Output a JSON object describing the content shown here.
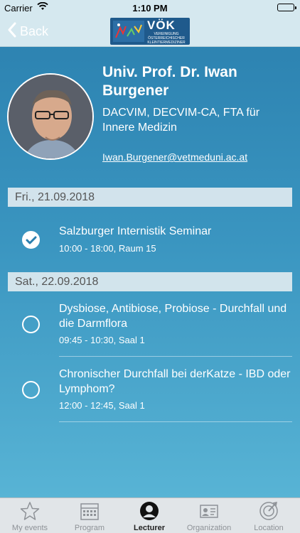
{
  "status_bar": {
    "carrier": "Carrier",
    "time": "1:10 PM"
  },
  "nav": {
    "back_label": "Back",
    "logo_text": "VÖK",
    "logo_subtext": "VEREINIGUNG ÖSTERREICHISCHER KLEINTIERMEDIZINER"
  },
  "lecturer": {
    "name": "Univ. Prof. Dr. Iwan Burgener",
    "qualifications": "DACVIM, DECVIM-CA, FTA für Innere Medizin",
    "email": "Iwan.Burgener@vetmeduni.ac.at"
  },
  "days": [
    {
      "label": "Fri., 21.09.2018",
      "sessions": [
        {
          "title": "Salzburger Internistik Seminar",
          "meta": "10:00 - 18:00, Raum 15",
          "selected": true
        }
      ]
    },
    {
      "label": "Sat., 22.09.2018",
      "sessions": [
        {
          "title": "Dysbiose, Antibiose, Probiose - Durchfall und die Darmflora",
          "meta": "09:45 - 10:30, Saal 1",
          "selected": false
        },
        {
          "title": "Chronischer Durchfall bei derKatze - IBD oder Lymphom?",
          "meta": "12:00 - 12:45, Saal 1",
          "selected": false
        }
      ]
    }
  ],
  "tabs": [
    {
      "label": "My events",
      "icon": "star-icon",
      "active": false
    },
    {
      "label": "Program",
      "icon": "calendar-icon",
      "active": false
    },
    {
      "label": "Lecturer",
      "icon": "person-icon",
      "active": true
    },
    {
      "label": "Organization",
      "icon": "id-card-icon",
      "active": false
    },
    {
      "label": "Location",
      "icon": "compass-icon",
      "active": false
    }
  ],
  "colors": {
    "accent": "#2a7fae",
    "bar": "#d5e8ef"
  }
}
